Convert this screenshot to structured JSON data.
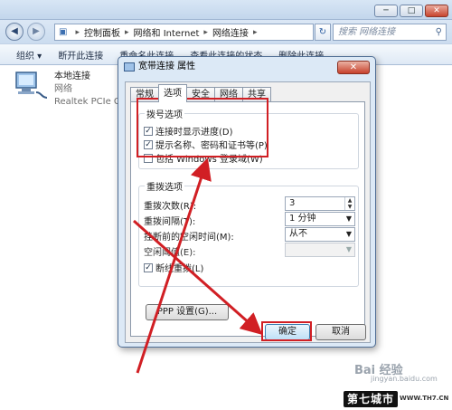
{
  "explorer": {
    "window_controls": {
      "minimize": "─",
      "maximize": "□",
      "close": "✕"
    },
    "nav": {
      "back": "◀",
      "forward": "▶"
    },
    "breadcrumb": [
      "控制面板",
      "网络和 Internet",
      "网络连接"
    ],
    "refresh": "↻",
    "search_placeholder": "搜索 网络连接",
    "search_icon": "search-icon",
    "toolbar": [
      "组织 ▾",
      "断开此连接",
      "重命名此连接",
      "查看此连接的状态",
      "删除此连接"
    ],
    "connection": {
      "name": "本地连接",
      "type": "网络",
      "adapter": "Realtek PCIe GB"
    }
  },
  "dialog": {
    "title": "宽带连接 属性",
    "close": "✕",
    "tabs": [
      "常规",
      "选项",
      "安全",
      "网络",
      "共享"
    ],
    "active_tab": "选项",
    "dialing_group": {
      "title": "拨号选项",
      "options": [
        {
          "label": "连接时显示进度(D)",
          "checked": true
        },
        {
          "label": "提示名称、密码和证书等(P)",
          "checked": true
        },
        {
          "label": "包括 Windows 登录域(W)",
          "checked": false
        }
      ]
    },
    "redial_group": {
      "title": "重拨选项",
      "redial_attempts_label": "重拨次数(R):",
      "redial_attempts_value": "3",
      "redial_interval_label": "重拨间隔(T):",
      "redial_interval_value": "1 分钟",
      "idle_hangup_label": "挂断前的空闲时间(M):",
      "idle_hangup_value": "从不",
      "idle_threshold_label": "空闲阈值(E):",
      "idle_threshold_value": "",
      "redial_if_dropped_label": "断线重拨(L)",
      "redial_if_dropped_checked": true
    },
    "ppp_button": "PPP 设置(G)...",
    "ok_button": "确定",
    "cancel_button": "取消"
  },
  "annotation": {
    "highlight_color": "#d11f24"
  },
  "watermark": {
    "baidu": "Bai 经验",
    "baidu_url": "jingyan.baidu.com",
    "site_logo": "第七城市",
    "site_url": "WWW.TH7.CN"
  }
}
